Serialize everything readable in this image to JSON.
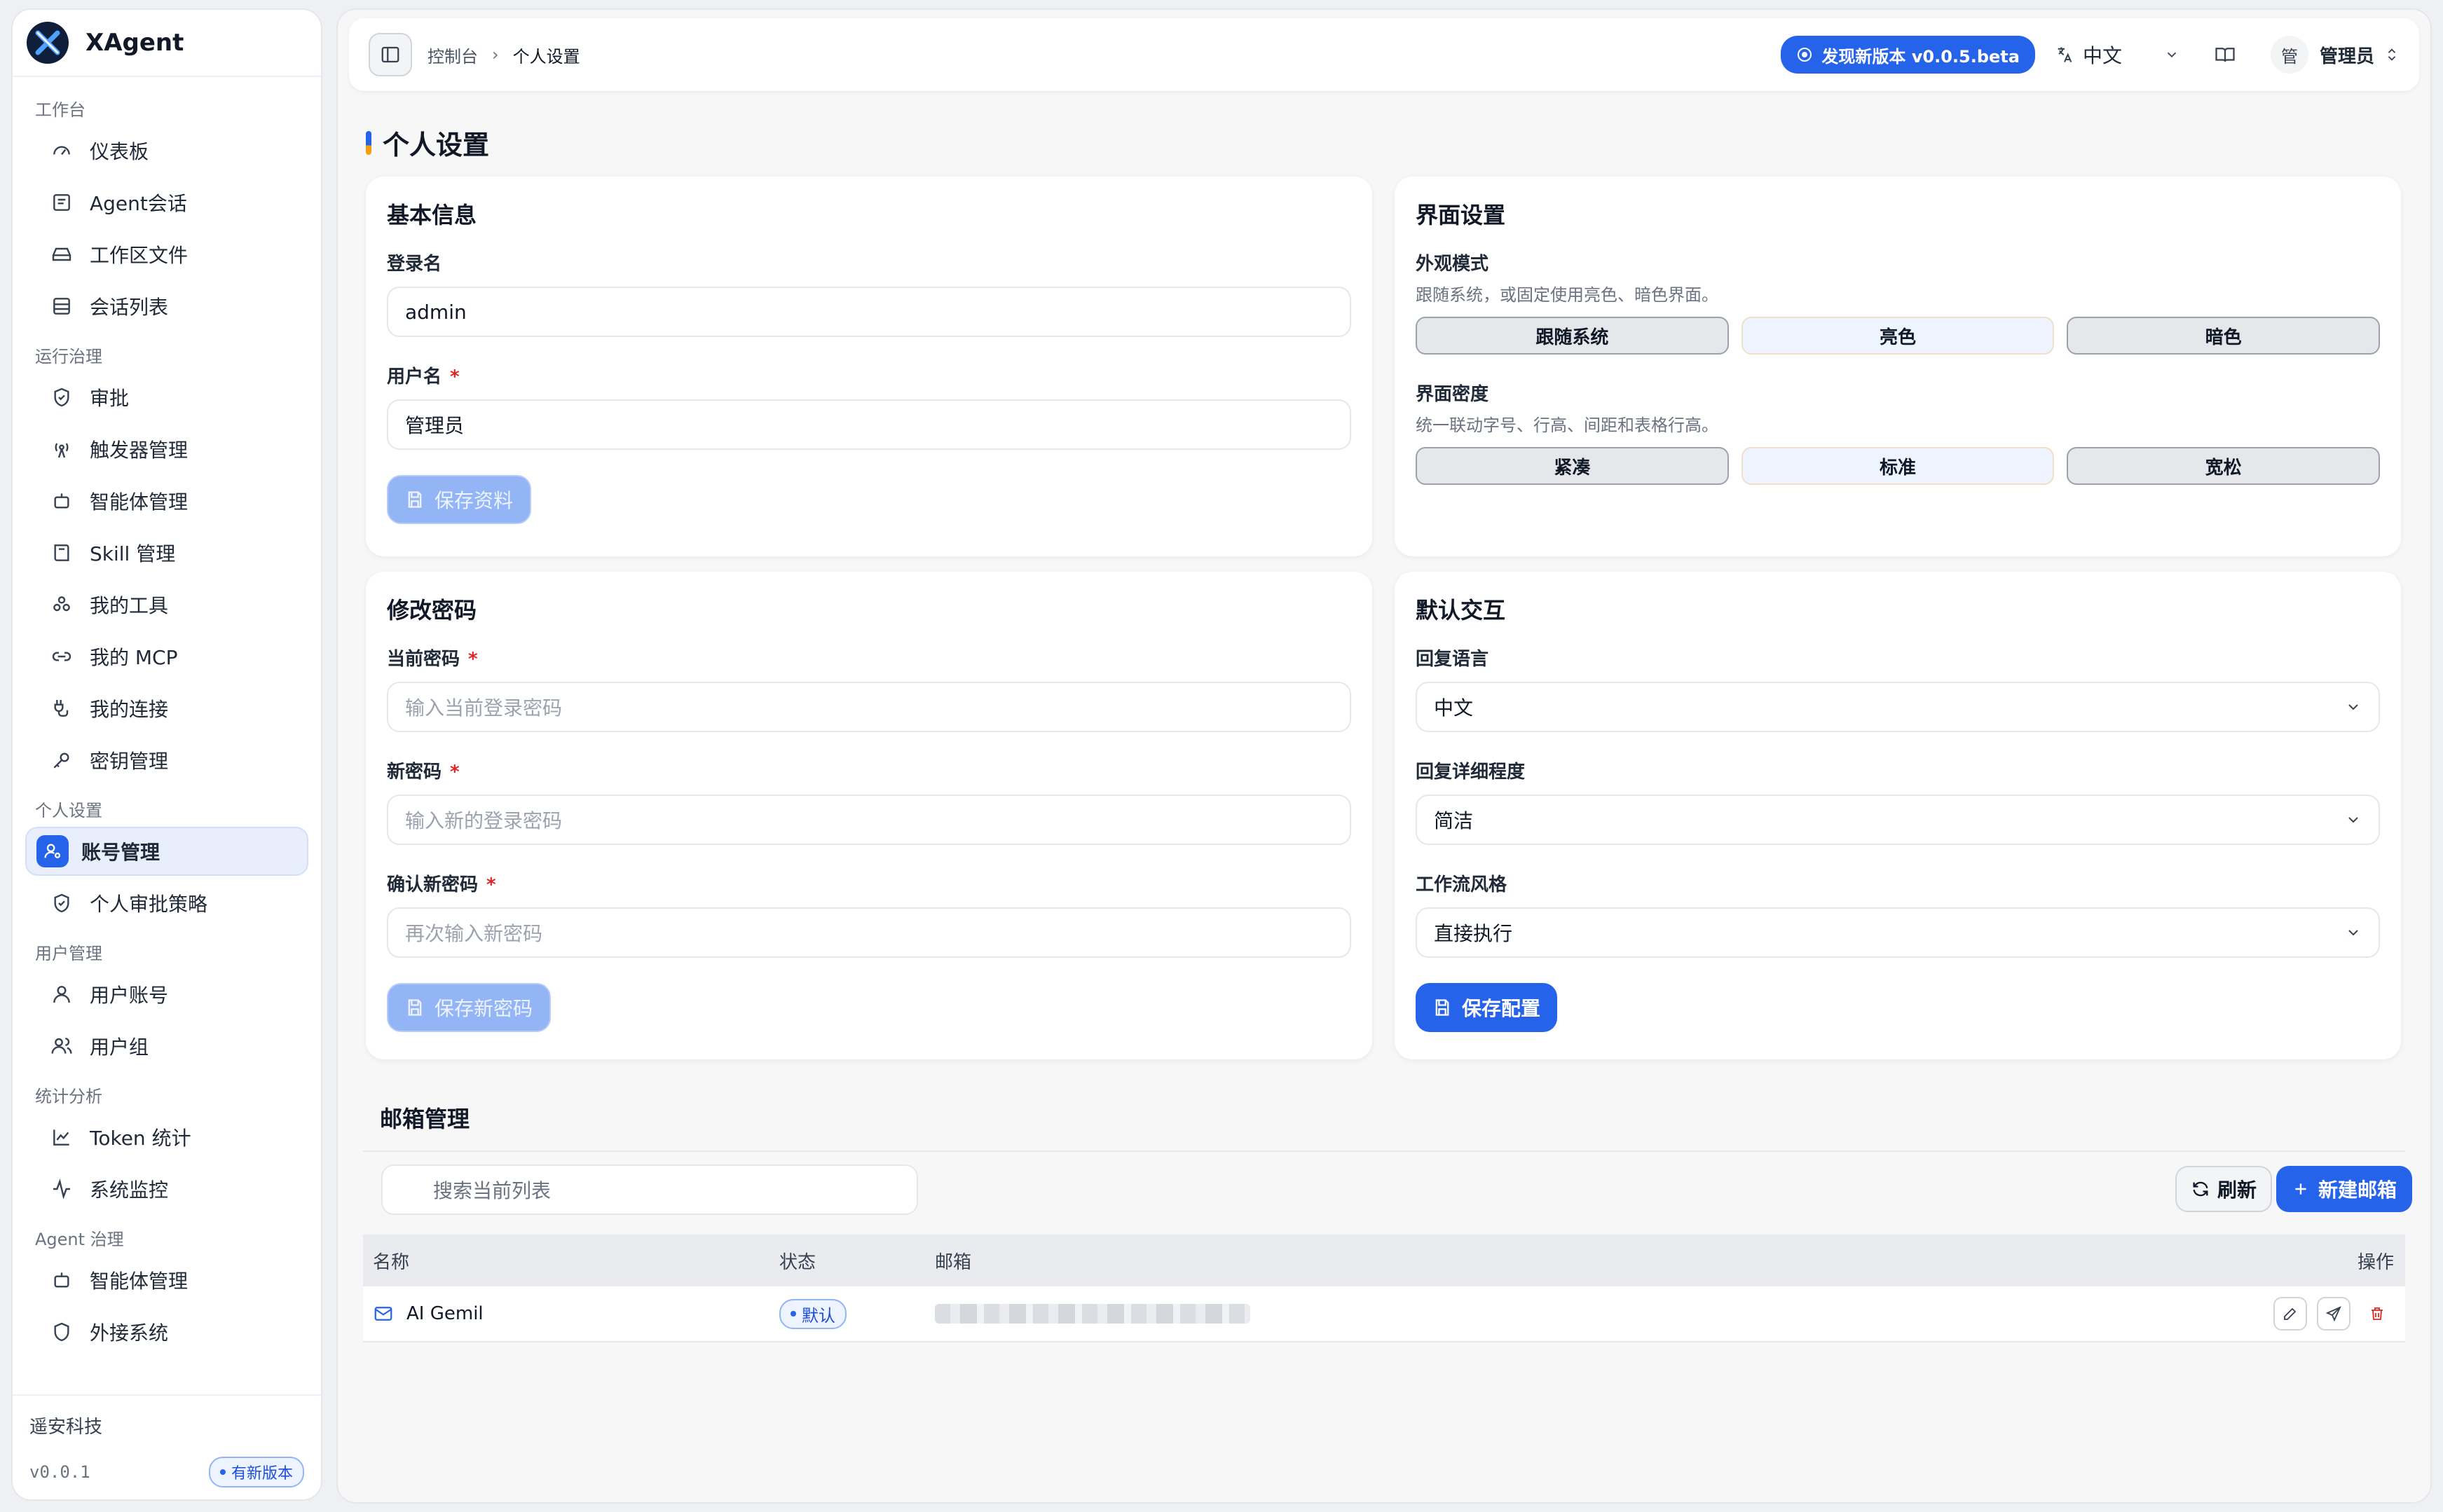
{
  "app": {
    "name": "XAgent"
  },
  "sidebar": {
    "sections": [
      {
        "title": "工作台",
        "items": [
          "仪表板",
          "Agent会话",
          "工作区文件",
          "会话列表"
        ]
      },
      {
        "title": "运行治理",
        "items": [
          "审批",
          "触发器管理",
          "智能体管理",
          "Skill 管理",
          "我的工具",
          "我的 MCP",
          "我的连接",
          "密钥管理"
        ]
      },
      {
        "title": "个人设置",
        "items": [
          "账号管理",
          "个人审批策略"
        ]
      },
      {
        "title": "用户管理",
        "items": [
          "用户账号",
          "用户组"
        ]
      },
      {
        "title": "统计分析",
        "items": [
          "Token 统计",
          "系统监控"
        ]
      },
      {
        "title": "Agent 治理",
        "items": [
          "智能体管理",
          "外接系统"
        ]
      }
    ],
    "active_item": "账号管理",
    "footer": {
      "company": "遥安科技",
      "version": "v0.0.1",
      "new_version_badge": "有新版本"
    }
  },
  "topbar": {
    "breadcrumb": [
      "控制台",
      "个人设置"
    ],
    "update_button": "发现新版本 v0.0.5.beta",
    "language": "中文",
    "user_avatar": "管",
    "user_name": "管理员"
  },
  "page": {
    "title": "个人设置"
  },
  "basic_info": {
    "title": "基本信息",
    "login_label": "登录名",
    "login_value": "admin",
    "username_label": "用户名",
    "username_value": "管理员",
    "save_button": "保存资料"
  },
  "password": {
    "title": "修改密码",
    "current_label": "当前密码",
    "current_placeholder": "输入当前登录密码",
    "new_label": "新密码",
    "new_placeholder": "输入新的登录密码",
    "confirm_label": "确认新密码",
    "confirm_placeholder": "再次输入新密码",
    "save_button": "保存新密码"
  },
  "ui_settings": {
    "title": "界面设置",
    "appearance_label": "外观模式",
    "appearance_desc": "跟随系统，或固定使用亮色、暗色界面。",
    "appearance_options": [
      "跟随系统",
      "亮色",
      "暗色"
    ],
    "appearance_selected": "亮色",
    "density_label": "界面密度",
    "density_desc": "统一联动字号、行高、间距和表格行高。",
    "density_options": [
      "紧凑",
      "标准",
      "宽松"
    ],
    "density_selected": "标准"
  },
  "interaction": {
    "title": "默认交互",
    "reply_lang_label": "回复语言",
    "reply_lang_value": "中文",
    "detail_label": "回复详细程度",
    "detail_value": "简洁",
    "workflow_label": "工作流风格",
    "workflow_value": "直接执行",
    "save_button": "保存配置"
  },
  "mailbox": {
    "title": "邮箱管理",
    "search_placeholder": "搜索当前列表",
    "refresh_button": "刷新",
    "new_button": "新建邮箱",
    "columns": [
      "名称",
      "状态",
      "邮箱",
      "操作"
    ],
    "rows": [
      {
        "name": "AI Gemil",
        "status": "默认",
        "email": ""
      }
    ]
  },
  "colors": {
    "accent": "#2563eb",
    "danger": "#dc2626"
  }
}
